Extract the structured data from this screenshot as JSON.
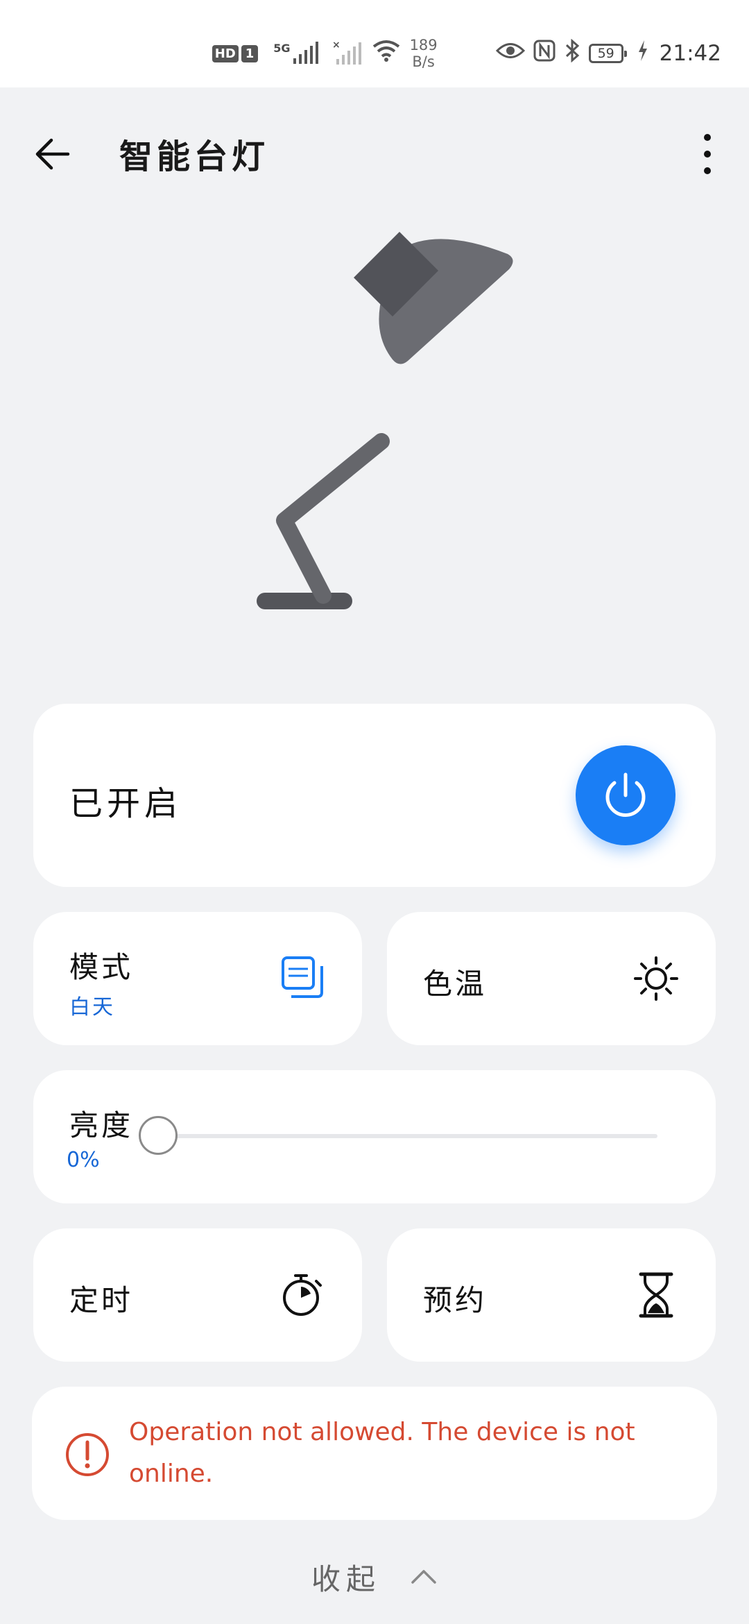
{
  "status_bar": {
    "hd_label": "HD",
    "sim_label": "1",
    "network_label": "5G",
    "net_speed_value": "189",
    "net_speed_unit": "B/s",
    "battery_level": "59",
    "time": "21:42"
  },
  "app_bar": {
    "title": "智能台灯"
  },
  "power": {
    "status_label": "已开启",
    "button_color": "#1a7ef5"
  },
  "mode": {
    "label": "模式",
    "value": "白天"
  },
  "color_temperature": {
    "label": "色温"
  },
  "brightness": {
    "label": "亮度",
    "value": "0%",
    "level": 0
  },
  "timer": {
    "label": "定时"
  },
  "schedule": {
    "label": "预约"
  },
  "error": {
    "message": "Operation not allowed. The device is not online.",
    "color": "#d54a32"
  },
  "collapse": {
    "label": "收起"
  }
}
